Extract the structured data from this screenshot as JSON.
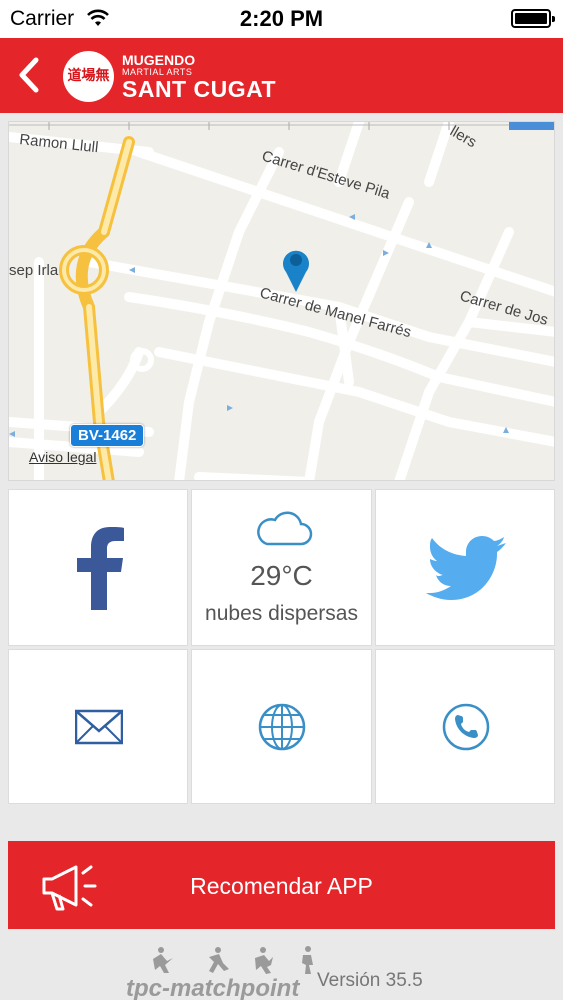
{
  "status_bar": {
    "carrier": "Carrier",
    "time": "2:20 PM"
  },
  "header": {
    "logo_text": "道場無",
    "brand_line1": "MUGENDO",
    "brand_line2": "MARTIAL ARTS",
    "brand_line3": "SANT CUGAT",
    "brand_color": "#e4252a"
  },
  "map": {
    "streets": {
      "ramon_llull": "Ramon Llull",
      "esteve_pila": "Carrer d'Esteve Pila",
      "manel_farres": "Carrer de Manel Farrés",
      "carrer_de_jos": "Carrer de Jos",
      "sep_irla": "sep Irla",
      "llers": "llers"
    },
    "road_badge": "BV-1462",
    "legal_link": "Aviso legal"
  },
  "tiles": {
    "facebook_icon": "facebook-icon",
    "weather": {
      "icon": "cloud-icon",
      "temperature": "29°C",
      "condition": "nubes dispersas"
    },
    "twitter_icon": "twitter-icon",
    "email_icon": "envelope-icon",
    "web_icon": "globe-icon",
    "phone_icon": "phone-icon"
  },
  "cta": {
    "icon": "megaphone-icon",
    "label": "Recomendar APP"
  },
  "footer": {
    "brand": "tpc-matchpoint",
    "version": "Versión 35.5"
  },
  "colors": {
    "facebook": "#3b5998",
    "twitter": "#55acee",
    "icon_blue": "#3a8fc6"
  }
}
